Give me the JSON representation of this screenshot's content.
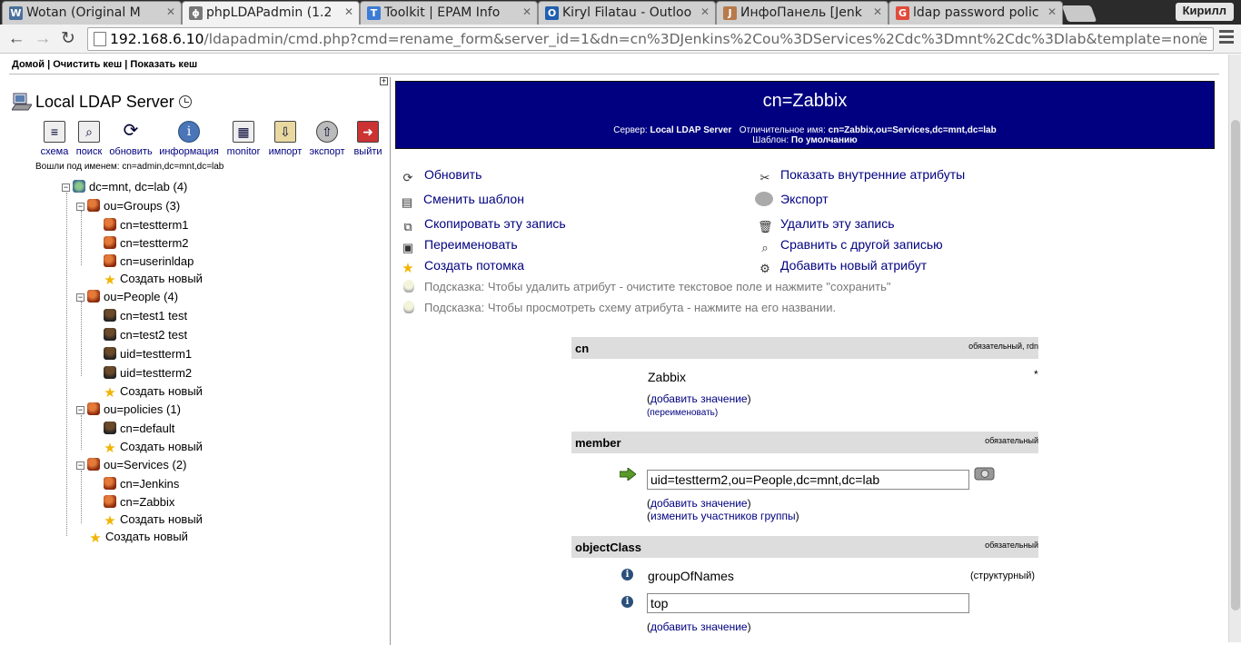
{
  "browser": {
    "tabs": [
      {
        "title": "Wotan (Original M",
        "icon": "vk-icon",
        "color": "#4a6f9c",
        "glyph": "W"
      },
      {
        "title": "phpLDAPadmin (1.2",
        "icon": "ldap-icon",
        "color": "#777",
        "glyph": "ϕ"
      },
      {
        "title": "Toolkit | EPAM Info",
        "icon": "toolkit-icon",
        "color": "#3d7bd6",
        "glyph": "T"
      },
      {
        "title": "Kiryl Filatau - Outloo",
        "icon": "outlook-icon",
        "color": "#1f5fb0",
        "glyph": "O"
      },
      {
        "title": "ИнфоПанель [Jenk",
        "icon": "jenkins-icon",
        "color": "#b87a4a",
        "glyph": "J"
      },
      {
        "title": "ldap password polic",
        "icon": "google-icon",
        "color": "#e04b3a",
        "glyph": "G"
      }
    ],
    "user": "Кирилл",
    "url_host": "192.168.6.10",
    "url_path": "/ldapadmin/cmd.php?cmd=rename_form&server_id=1&dn=cn%3DJenkins%2Cou%3DServices%2Cdc%3Dmnt%2Cdc%3Dlab&template=none"
  },
  "topnav": {
    "home": "Домой",
    "clear_cache": "Очистить кеш",
    "show_cache": "Показать кеш",
    "sep": "|"
  },
  "server": {
    "title": "Local LDAP Server",
    "logged_in": "Вошли под именем: cn=admin,dc=mnt,dc=lab",
    "tools": [
      {
        "label": "схема",
        "icon": "schema-icon",
        "glyph": "≡"
      },
      {
        "label": "поиск",
        "icon": "search-icon",
        "glyph": "⌕"
      },
      {
        "label": "обновить",
        "icon": "refresh-icon",
        "glyph": "⟳"
      },
      {
        "label": "информация",
        "icon": "info-icon",
        "glyph": "i"
      },
      {
        "label": "monitor",
        "icon": "monitor-icon",
        "glyph": "▦"
      },
      {
        "label": "импорт",
        "icon": "import-icon",
        "glyph": "⇩"
      },
      {
        "label": "экспорт",
        "icon": "export-icon",
        "glyph": "⇧"
      },
      {
        "label": "выйти",
        "icon": "logout-icon",
        "glyph": "➜"
      }
    ]
  },
  "tree": {
    "root": "dc=mnt, dc=lab (4)",
    "groups": "ou=Groups (3)",
    "g1": "cn=testterm1",
    "g2": "cn=testterm2",
    "g3": "cn=userinldap",
    "people": "ou=People (4)",
    "p1": "cn=test1 test",
    "p2": "cn=test2 test",
    "p3": "uid=testterm1",
    "p4": "uid=testterm2",
    "policies": "ou=policies (1)",
    "pol1": "cn=default",
    "services": "ou=Services (2)",
    "s1": "cn=Jenkins",
    "s2": "cn=Zabbix",
    "create": "Создать новый"
  },
  "entry": {
    "title": "cn=Zabbix",
    "server_label": "Сервер:",
    "server_value": "Local LDAP Server",
    "dn_label": "Отличительное имя:",
    "dn_value": "cn=Zabbix,ou=Services,dc=mnt,dc=lab",
    "template_label": "Шаблон:",
    "template_value": "По умолчанию"
  },
  "actions": {
    "refresh": "Обновить",
    "change_template": "Сменить шаблон",
    "copy": "Скопировать эту запись",
    "rename": "Переименовать",
    "create_child": "Создать потомка",
    "show_internal": "Показать внутренние атрибуты",
    "export": "Экспорт",
    "delete": "Удалить эту запись",
    "compare": "Сравнить с другой записью",
    "add_attr": "Добавить новый атрибут"
  },
  "hints": {
    "h1": "Подсказка: Чтобы удалить атрибут - очистите текстовое поле и нажмите \"сохранить\"",
    "h2": "Подсказка: Чтобы просмотреть схему атрибута - нажмите на его названии."
  },
  "attributes": {
    "cn": {
      "name": "cn",
      "req": "обязательный, rdn",
      "value": "Zabbix",
      "star": "*",
      "add": "добавить значение",
      "rename": "переименовать"
    },
    "member": {
      "name": "member",
      "req": "обязательный",
      "value": "uid=testterm2,ou=People,dc=mnt,dc=lab",
      "add": "добавить значение",
      "modify": "изменить участников группы"
    },
    "objectClass": {
      "name": "objectClass",
      "req": "обязательный",
      "v1": "groupOfNames",
      "v1_note": "(структурный)",
      "v2": "top",
      "add": "добавить значение"
    }
  }
}
